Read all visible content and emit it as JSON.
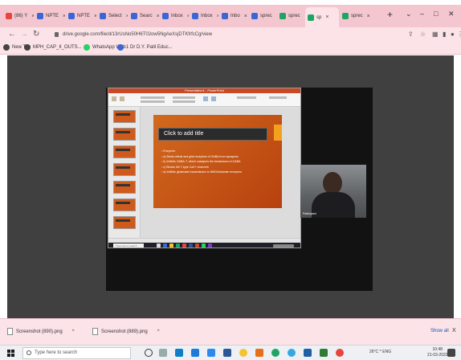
{
  "browser": {
    "tabs": [
      {
        "label": "(86) Y",
        "icon_color": "#e8453c",
        "active": false
      },
      {
        "label": "NPTE",
        "icon_color": "#3a66d6",
        "active": false
      },
      {
        "label": "NPTE",
        "icon_color": "#3a66d6",
        "active": false
      },
      {
        "label": "Select",
        "icon_color": "#3a66d6",
        "active": false
      },
      {
        "label": "Searc",
        "icon_color": "#3a66d6",
        "active": false
      },
      {
        "label": "Inbox",
        "icon_color": "#3a66d6",
        "active": false
      },
      {
        "label": "Inbox",
        "icon_color": "#3a66d6",
        "active": false
      },
      {
        "label": "Inbo",
        "icon_color": "#3a66d6",
        "active": false
      },
      {
        "label": "sprec",
        "icon_color": "#3a66d6",
        "active": false
      },
      {
        "label": "sprec",
        "icon_color": "#1fa463",
        "active": false
      },
      {
        "label": "sp",
        "icon_color": "#1fa463",
        "active": true
      },
      {
        "label": "sprec",
        "icon_color": "#1fa463",
        "active": false
      }
    ],
    "new_tab_label": "+",
    "window_controls": {
      "minimize": "–",
      "maximize": "□",
      "close": "✕",
      "dropdown": "⌄"
    },
    "url": "drive.google.com/file/d/13rUsNo50H6T02ow5NgAeXsjDTKfrfcCg/view",
    "bookmarks": [
      {
        "label": "New Tab",
        "icon_color": "#444444"
      },
      {
        "label": "MPH_CAP_II_OUTS...",
        "icon_color": "#444444"
      },
      {
        "label": "WhatsApp Web",
        "icon_color": "#25d366"
      },
      {
        "label": "1 Dr D.Y. Patil Educ...",
        "icon_color": "#3a66d6"
      }
    ]
  },
  "viewer": {
    "powerpoint": {
      "window_title": "Presentation1 - PowerPoint",
      "slide_title": "Click to add title",
      "bullets": [
        "Enzymes",
        "a) Binds retinal and glial receptors of GABA from synapses",
        "b) Inhibits GABA-T, which catalyzes the breakdown of GABA",
        "c) Blocks the T-type Ca2+ channels",
        "d) Inhibits glutamate transmission to NMDA/kainate receptors"
      ],
      "taskbar_search": "Type here to search"
    },
    "webcam_label": "Participant"
  },
  "downloads": {
    "items": [
      {
        "label": "Screenshot (890).png"
      },
      {
        "label": "Screenshot (889).png"
      }
    ],
    "show_all": "Show all",
    "close": "X"
  },
  "taskbar": {
    "search_placeholder": "Type here to search",
    "tray_text": "26°C  ^  ENG",
    "time": "10:48",
    "date": "21-03-2022"
  },
  "colors": {
    "tab_bar": "#f4c7d0",
    "chrome_bg": "#fbe3e8",
    "viewer_bg": "#404040",
    "slide_orange": "#d2691e"
  }
}
